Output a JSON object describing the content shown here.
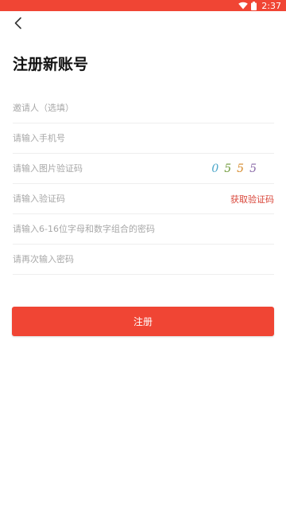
{
  "status_bar": {
    "time": "2:37",
    "icons": [
      "wifi-icon",
      "battery-icon"
    ]
  },
  "header": {
    "back_icon": "chevron-left-icon",
    "title": "注册新账号"
  },
  "form": {
    "inviter_placeholder": "邀请人（选填）",
    "phone_placeholder": "请输入手机号",
    "image_captcha_placeholder": "请输入图片验证码",
    "captcha_digits": [
      "0",
      "5",
      "5",
      "5"
    ],
    "captcha_colors": [
      "#4aa6c9",
      "#6f9a3a",
      "#d68a2b",
      "#8a6aa8"
    ],
    "sms_code_placeholder": "请输入验证码",
    "get_code_label": "获取验证码",
    "password_placeholder": "请输入6-16位字母和数字组合的密码",
    "confirm_password_placeholder": "请再次输入密码"
  },
  "actions": {
    "register_label": "注册"
  },
  "colors": {
    "accent": "#f04534",
    "link": "#d9463a"
  }
}
